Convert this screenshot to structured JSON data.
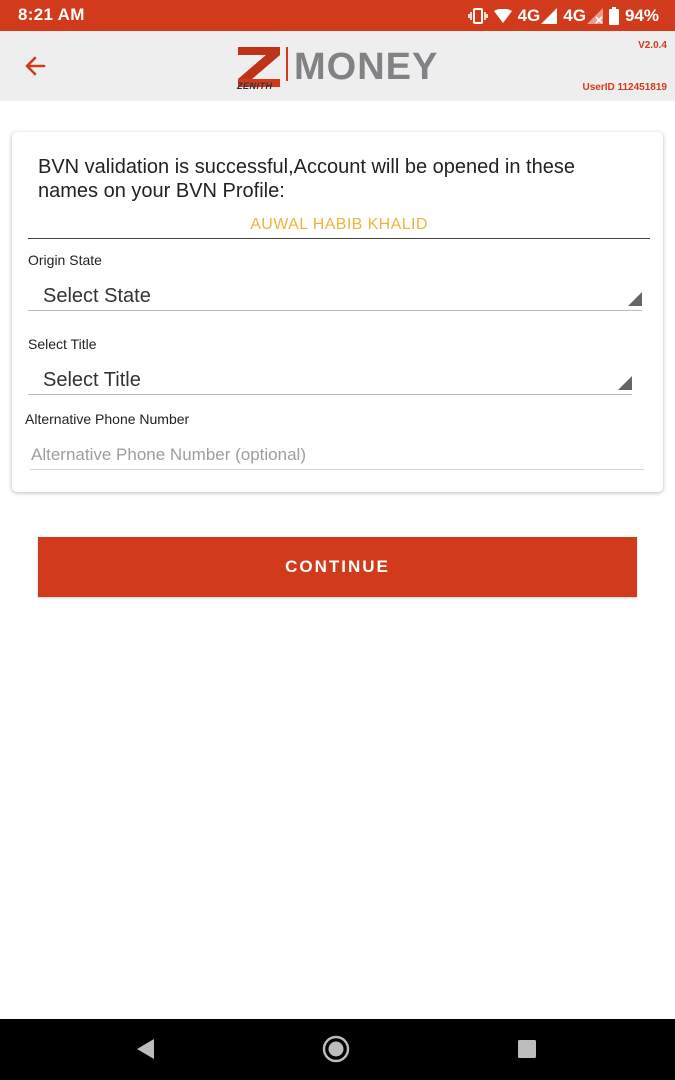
{
  "status_bar": {
    "time": "8:21 AM",
    "network_1": "4G",
    "network_2": "4G",
    "battery": "94%",
    "color": "#d23a1c"
  },
  "header": {
    "logo_text": "MONEY",
    "logo_sub": "ZENITH",
    "version": "V2.0.4",
    "user_id": "UserID 112451819",
    "back_icon": "arrow-left-icon",
    "accent_color": "#d23a1c"
  },
  "form": {
    "bvn_message": "BVN validation is successful,Account will be opened in these names on your BVN Profile:",
    "bvn_name": "AUWAL HABIB KHALID",
    "bvn_name_color": "#f2b33d",
    "origin_state": {
      "label": "Origin State",
      "value": "Select State"
    },
    "title": {
      "label": "Select Title",
      "value": "Select Title"
    },
    "alt_phone": {
      "label": "Alternative Phone Number",
      "placeholder": "Alternative Phone Number (optional)",
      "value": ""
    }
  },
  "continue_button": {
    "label": "CONTINUE"
  },
  "nav_bar": {
    "back_icon": "nav-back-icon",
    "home_icon": "nav-home-icon",
    "recents_icon": "nav-recents-icon"
  }
}
